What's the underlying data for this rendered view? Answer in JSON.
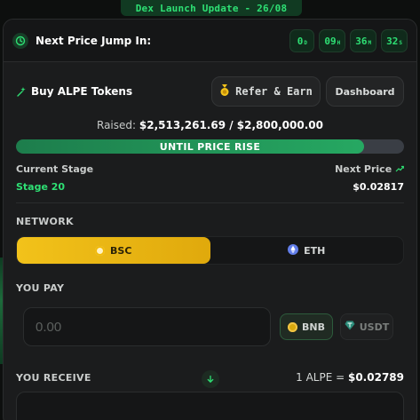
{
  "banner": {
    "text": "Dex Launch Update - 26/08"
  },
  "timer": {
    "label": "Next Price Jump In:",
    "units": [
      {
        "value": "0",
        "unit": "D"
      },
      {
        "value": "09",
        "unit": "H"
      },
      {
        "value": "36",
        "unit": "M"
      },
      {
        "value": "32",
        "unit": "S"
      }
    ]
  },
  "buy": {
    "title": "Buy ALPE Tokens",
    "refer_label": "Refer & Earn",
    "dashboard_label": "Dashboard"
  },
  "raised": {
    "label": "Raised:",
    "amount": "$2,513,261.69 / $2,800,000.00"
  },
  "progress": {
    "text": "UNTIL PRICE RISE",
    "fraction": 0.8976,
    "fill_color": "#23955a"
  },
  "stage": {
    "current_label": "Current Stage",
    "current_value": "Stage 20",
    "next_label": "Next Price",
    "next_value": "$0.02817"
  },
  "network": {
    "label": "NETWORK",
    "options": [
      {
        "label": "BSC",
        "active": true,
        "icon": "bnb-coin-icon"
      },
      {
        "label": "ETH",
        "active": false,
        "icon": "eth-coin-icon"
      }
    ]
  },
  "pay": {
    "label": "YOU PAY",
    "placeholder": "0.00",
    "tokens": [
      {
        "label": "BNB",
        "selected": true,
        "icon": "bnb-coin-icon"
      },
      {
        "label": "USDT",
        "selected": false,
        "icon": "usdt-coin-icon"
      }
    ]
  },
  "receive": {
    "label": "YOU RECEIVE",
    "rate_prefix": "1 ALPE = ",
    "rate_value": "$0.02789"
  },
  "colors": {
    "accent_green": "#2ee074",
    "bsc_yellow": "#f2c21a",
    "card_bg": "#1b1c1d"
  }
}
